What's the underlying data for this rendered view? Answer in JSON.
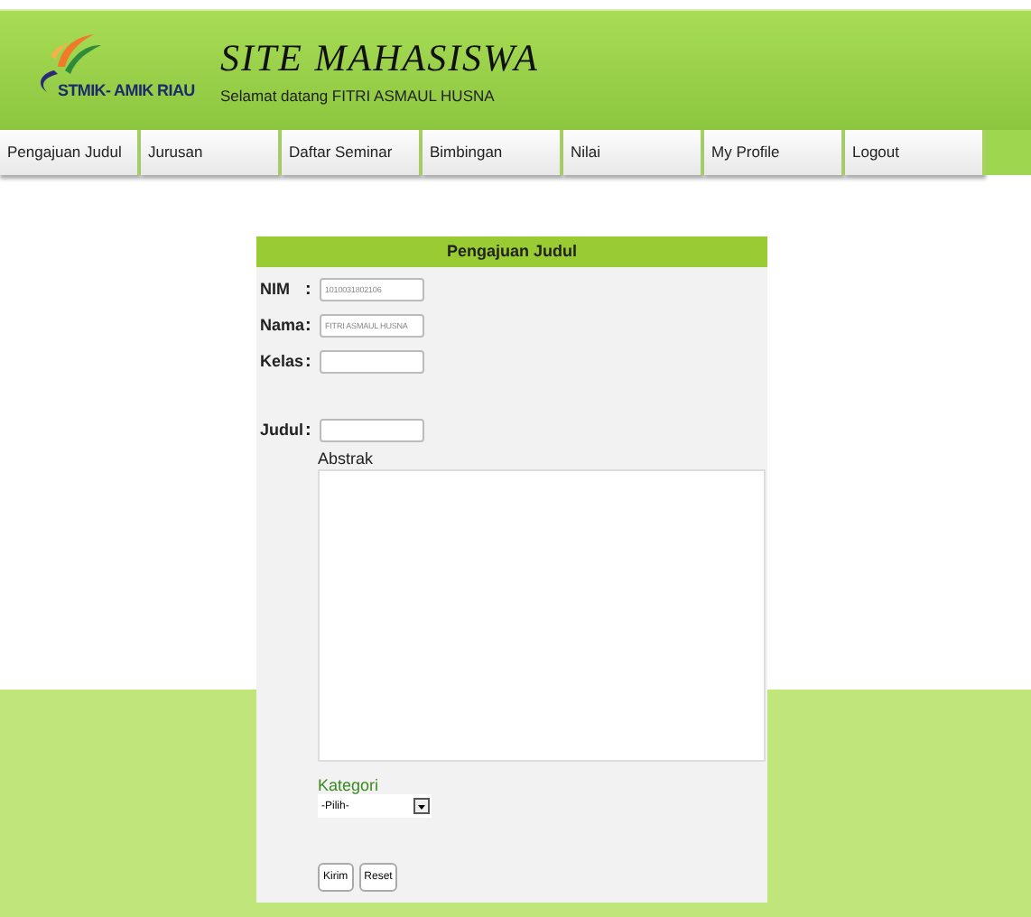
{
  "header": {
    "logo_text": "STMIK- AMIK RIAU",
    "title": "SITE MAHASISWA",
    "welcome": "Selamat datang FITRI ASMAUL HUSNA"
  },
  "nav": [
    {
      "label": "Pengajuan Judul"
    },
    {
      "label": "Jurusan"
    },
    {
      "label": "Daftar Seminar"
    },
    {
      "label": "Bimbingan"
    },
    {
      "label": "Nilai"
    },
    {
      "label": "My Profile"
    },
    {
      "label": "Logout"
    }
  ],
  "form": {
    "title": "Pengajuan Judul",
    "fields": [
      {
        "label": "NIM",
        "separator": ":",
        "value": "1010031802106"
      },
      {
        "label": "Nama",
        "separator": ":",
        "value": "FITRI ASMAUL HUSNA"
      },
      {
        "label": "Kelas",
        "separator": ":"
      },
      {
        "label": "Judul",
        "separator": ":"
      }
    ],
    "abstract_label": "Abstrak",
    "category_label": "Kategori",
    "category_value": "-Pilih-",
    "buttons": [
      "Kirim",
      "Reset"
    ]
  }
}
